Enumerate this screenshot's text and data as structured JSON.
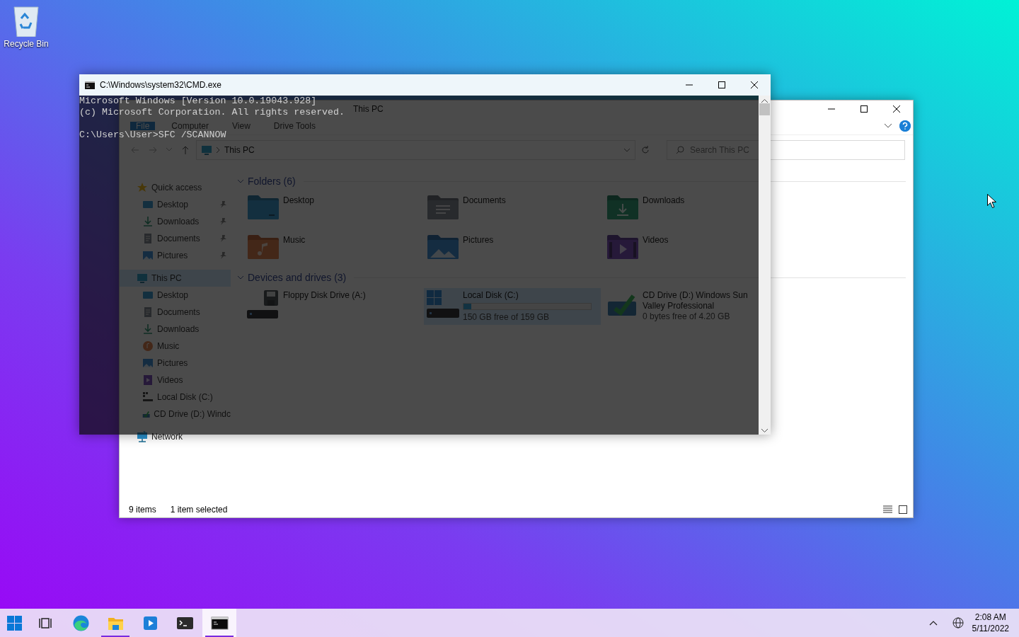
{
  "desktop_icons": [
    {
      "kind": "recycle-bin",
      "label": "Recycle Bin"
    }
  ],
  "explorer": {
    "title": "This PC",
    "ribbon_tabs": [
      {
        "kind": "file",
        "label": "File"
      },
      {
        "kind": "tab",
        "label": "Computer"
      },
      {
        "kind": "tab",
        "label": "View"
      },
      {
        "kind": "tab",
        "label": "Drive Tools"
      }
    ],
    "address": {
      "path": "This PC"
    },
    "search": {
      "placeholder": "Search This PC"
    },
    "nav": [
      {
        "kind": "star",
        "label": "Quick access",
        "selected": false,
        "children": [
          {
            "kind": "desktop",
            "label": "Desktop",
            "pinned": true,
            "selected": false
          },
          {
            "kind": "downloads",
            "label": "Downloads",
            "pinned": true,
            "selected": false
          },
          {
            "kind": "documents",
            "label": "Documents",
            "pinned": true,
            "selected": false
          },
          {
            "kind": "pictures",
            "label": "Pictures",
            "pinned": true,
            "selected": false
          }
        ]
      },
      {
        "kind": "pc",
        "label": "This PC",
        "selected": true,
        "children": [
          {
            "kind": "desktop",
            "label": "Desktop",
            "pinned": false,
            "selected": false
          },
          {
            "kind": "documents",
            "label": "Documents",
            "pinned": false,
            "selected": false
          },
          {
            "kind": "downloads",
            "label": "Downloads",
            "pinned": false,
            "selected": false
          },
          {
            "kind": "music",
            "label": "Music",
            "pinned": false,
            "selected": false
          },
          {
            "kind": "pictures",
            "label": "Pictures",
            "pinned": false,
            "selected": false
          },
          {
            "kind": "videos",
            "label": "Videos",
            "pinned": false,
            "selected": false
          },
          {
            "kind": "disk",
            "label": "Local Disk (C:)",
            "pinned": false,
            "selected": false
          },
          {
            "kind": "cd",
            "label": "CD Drive (D:) Windc",
            "pinned": false,
            "selected": false
          }
        ]
      },
      {
        "kind": "network",
        "label": "Network",
        "selected": false
      }
    ],
    "groups": [
      {
        "title": "Folders (6)",
        "expanded": true,
        "items": [
          {
            "kind": "desktop",
            "name": "Desktop",
            "selected": false
          },
          {
            "kind": "documents",
            "name": "Documents",
            "selected": false
          },
          {
            "kind": "downloads",
            "name": "Downloads",
            "selected": false
          },
          {
            "kind": "music",
            "name": "Music",
            "selected": false
          },
          {
            "kind": "pictures",
            "name": "Pictures",
            "selected": false
          },
          {
            "kind": "videos",
            "name": "Videos",
            "selected": false
          }
        ]
      },
      {
        "title": "Devices and drives (3)",
        "expanded": true,
        "items": [
          {
            "kind": "floppy",
            "name": "Floppy Disk Drive (A:)",
            "selected": false
          },
          {
            "kind": "disk",
            "name": "Local Disk (C:)",
            "selected": true,
            "level": 0.06,
            "free": "150 GB free of 159 GB"
          },
          {
            "kind": "cd",
            "name": "CD Drive (D:) Windows Sun Valley Professional",
            "selected": false,
            "free": "0 bytes free of 4.20 GB"
          }
        ]
      }
    ],
    "status_bar": {
      "item_count": "9 items",
      "selection": "1 item selected"
    }
  },
  "cmd": {
    "title": "C:\\Windows\\system32\\CMD.exe",
    "output": [
      "Microsoft Windows [Version 10.0.19043.928]",
      "(c) Microsoft Corporation. All rights reserved."
    ],
    "prompt": "C:\\Users\\User>SFC /SCANNOW"
  },
  "taskbar": {
    "apps": [
      {
        "kind": "start",
        "running": false,
        "active": false
      },
      {
        "kind": "task-view",
        "running": false,
        "active": false
      },
      {
        "kind": "browser",
        "running": false,
        "active": false
      },
      {
        "kind": "file-explorer",
        "running": true,
        "active": false
      },
      {
        "kind": "media-player",
        "running": false,
        "active": false
      },
      {
        "kind": "terminal",
        "running": false,
        "active": false
      },
      {
        "kind": "command-prompt",
        "running": true,
        "active": true
      }
    ],
    "clock": {
      "time": "2:08 AM",
      "date": "5/11/2022"
    }
  }
}
